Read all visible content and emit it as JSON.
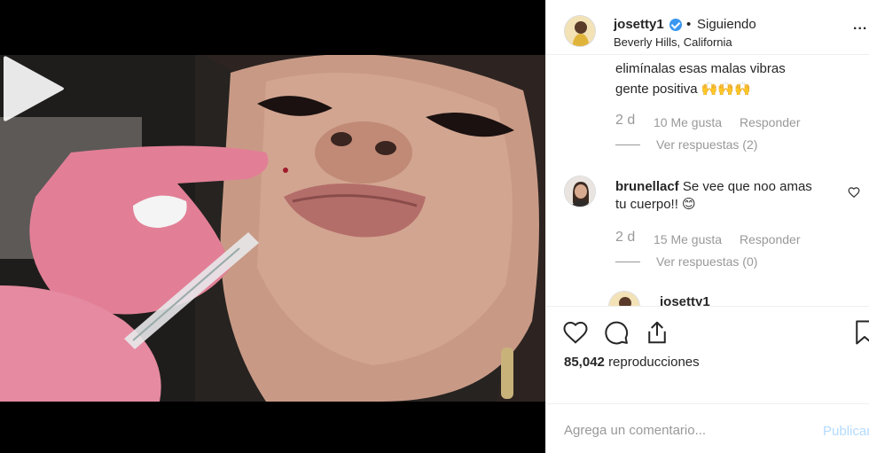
{
  "header": {
    "username": "josetty1",
    "separator": "•",
    "follow_label": "Siguiendo",
    "location": "Beverly Hills, California",
    "more_label": "..."
  },
  "comments": [
    {
      "text_line1": "elimínalas esas malas vibras",
      "text_line2": "gente positiva 🙌🙌🙌",
      "time": "2 d",
      "likes": "10 Me gusta",
      "reply": "Responder",
      "replies": "Ver respuestas (2)"
    },
    {
      "username": "brunellacf",
      "text_line1": "Se vee que noo amas",
      "text_line2": "tu cuerpo!! 😊",
      "time": "2 d",
      "likes": "15 Me gusta",
      "reply": "Responder",
      "replies": "Ver respuestas (0)"
    },
    {
      "username": "josetty1"
    }
  ],
  "actions": {
    "views_count": "85,042",
    "views_label": "reproducciones"
  },
  "comment_box": {
    "placeholder": "Agrega un comentario...",
    "publish_label": "Publicar"
  },
  "icons": {
    "play": "play-icon",
    "like": "heart-icon",
    "comment": "comment-icon",
    "share": "share-icon",
    "save": "bookmark-icon",
    "verified": "verified-badge-icon"
  },
  "colors": {
    "verified": "#3897f0",
    "muted_text": "#999999",
    "publish_disabled": "#b3dbff",
    "border": "#efefef"
  }
}
